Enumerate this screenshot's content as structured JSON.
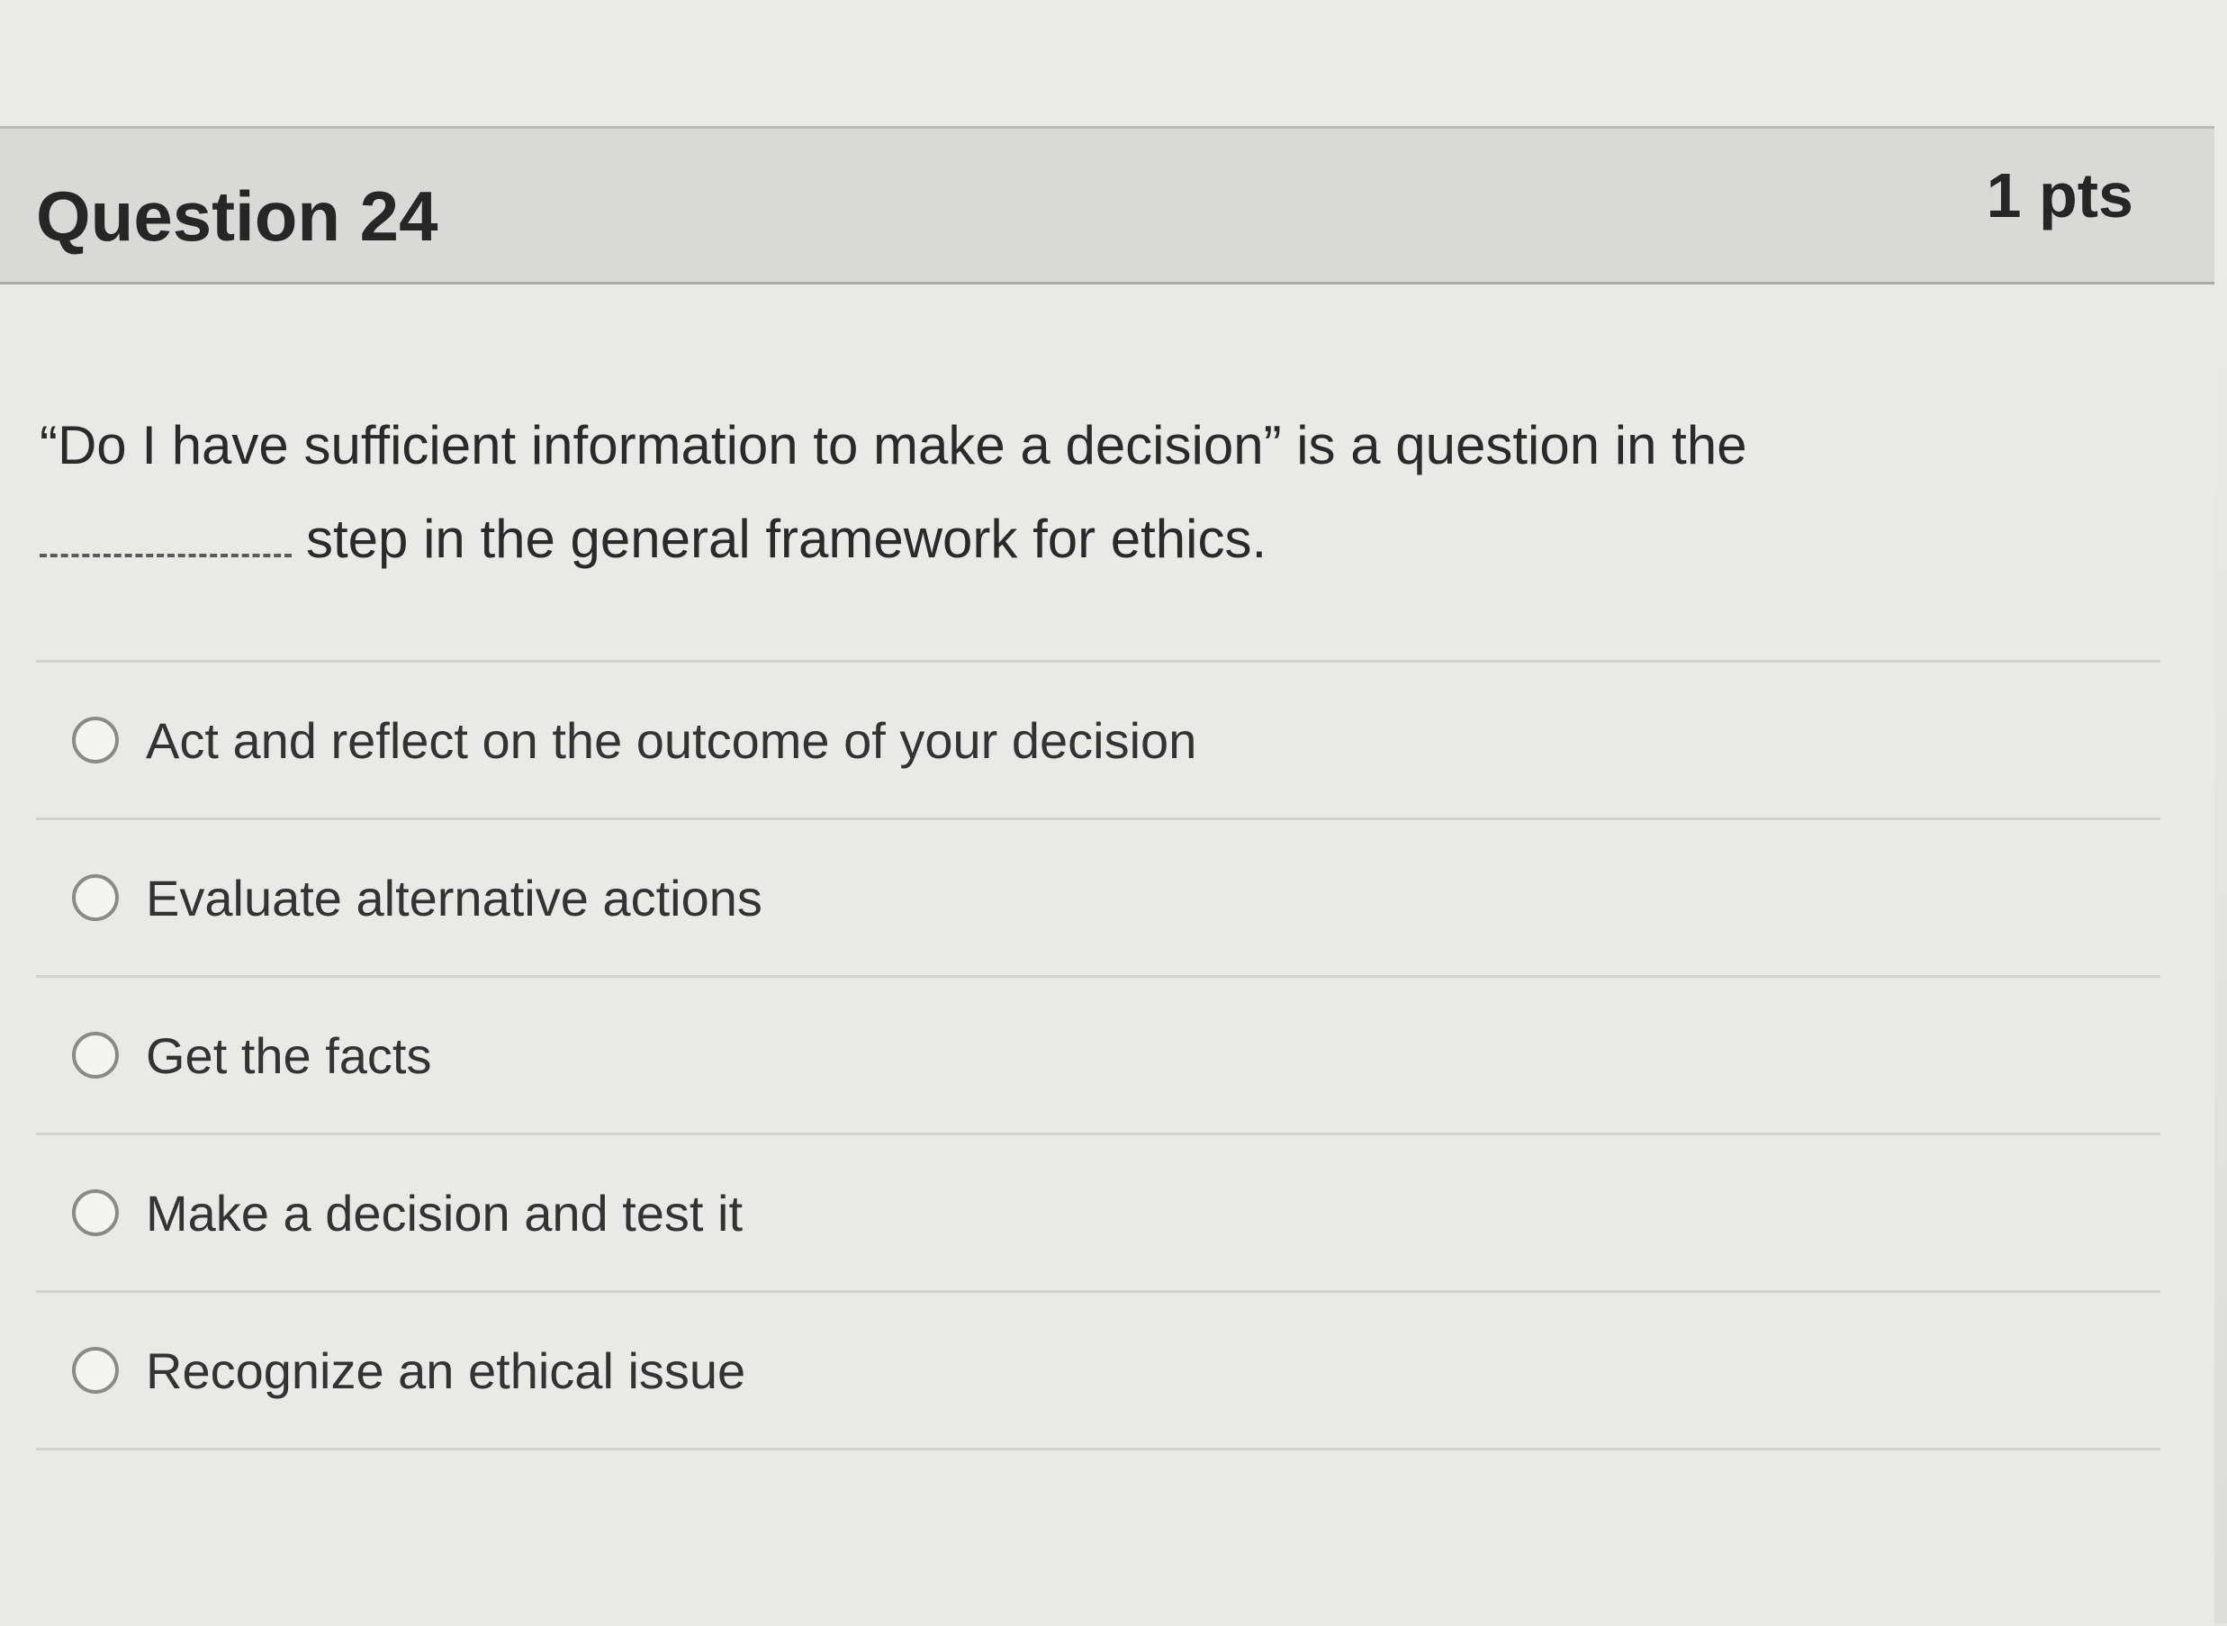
{
  "question": {
    "title": "Question 24",
    "points": "1 pts",
    "text_part1": "“Do I have sufficient information to make a decision” is a question in the",
    "text_part2": "step in the general framework for ethics."
  },
  "answers": [
    {
      "label": "Act and reflect on the outcome of your decision"
    },
    {
      "label": "Evaluate alternative actions"
    },
    {
      "label": "Get the facts"
    },
    {
      "label": "Make a decision and test it"
    },
    {
      "label": "Recognize an ethical issue"
    }
  ]
}
